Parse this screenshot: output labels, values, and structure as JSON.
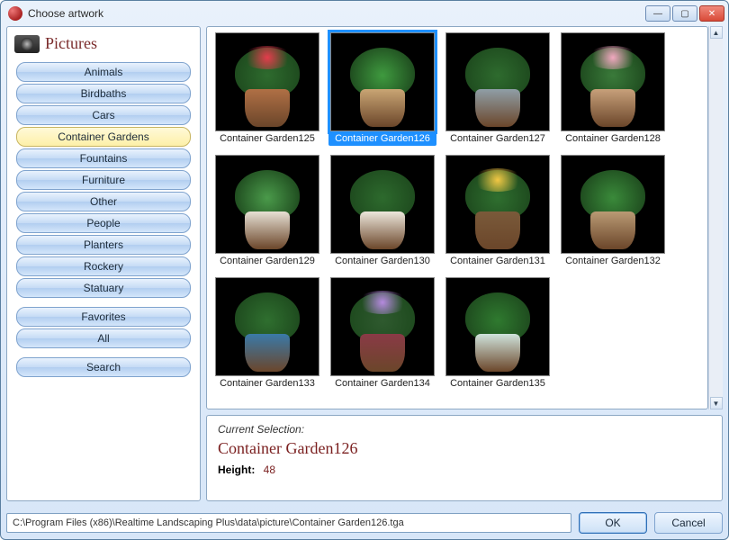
{
  "window": {
    "title": "Choose artwork"
  },
  "sidebar": {
    "title": "Pictures",
    "categories": [
      "Animals",
      "Birdbaths",
      "Cars",
      "Container Gardens",
      "Fountains",
      "Furniture",
      "Other",
      "People",
      "Planters",
      "Rockery",
      "Statuary",
      "Favorites",
      "All",
      "Search"
    ],
    "active_index": 3
  },
  "grid": {
    "items": [
      {
        "label": "Container Garden125",
        "pot": "#b07045",
        "fol": "#2e6b2e",
        "flw": "#e43c4c"
      },
      {
        "label": "Container Garden126",
        "pot": "#c9a574",
        "fol": "#3f9a3f",
        "flw": "transparent"
      },
      {
        "label": "Container Garden127",
        "pot": "#8f9ea6",
        "fol": "#2e6b2e",
        "flw": "transparent"
      },
      {
        "label": "Container Garden128",
        "pot": "#c7a07a",
        "fol": "#3a7a3a",
        "flw": "#f2a8c0"
      },
      {
        "label": "Container Garden129",
        "pot": "#e6e0d4",
        "fol": "#4a9a4a",
        "flw": "transparent"
      },
      {
        "label": "Container Garden130",
        "pot": "#ece7dc",
        "fol": "#2d6a2d",
        "flw": "transparent"
      },
      {
        "label": "Container Garden131",
        "pot": "#7a5a3a",
        "fol": "#2f6f2f",
        "flw": "#f2c844"
      },
      {
        "label": "Container Garden132",
        "pot": "#b99a74",
        "fol": "#3a8a3a",
        "flw": "transparent"
      },
      {
        "label": "Container Garden133",
        "pot": "#3a7aa8",
        "fol": "#2f6f2f",
        "flw": "transparent"
      },
      {
        "label": "Container Garden134",
        "pot": "#8a3a46",
        "fol": "#2f5a2f",
        "flw": "#b58adf"
      },
      {
        "label": "Container Garden135",
        "pot": "#cfe3dc",
        "fol": "#2f7a2f",
        "flw": "transparent"
      }
    ],
    "selected_index": 1
  },
  "selection": {
    "heading": "Current Selection:",
    "name": "Container Garden126",
    "height_label": "Height:",
    "height_value": "48"
  },
  "path": "C:\\Program Files (x86)\\Realtime Landscaping Plus\\data\\picture\\Container Garden126.tga",
  "buttons": {
    "ok": "OK",
    "cancel": "Cancel"
  }
}
